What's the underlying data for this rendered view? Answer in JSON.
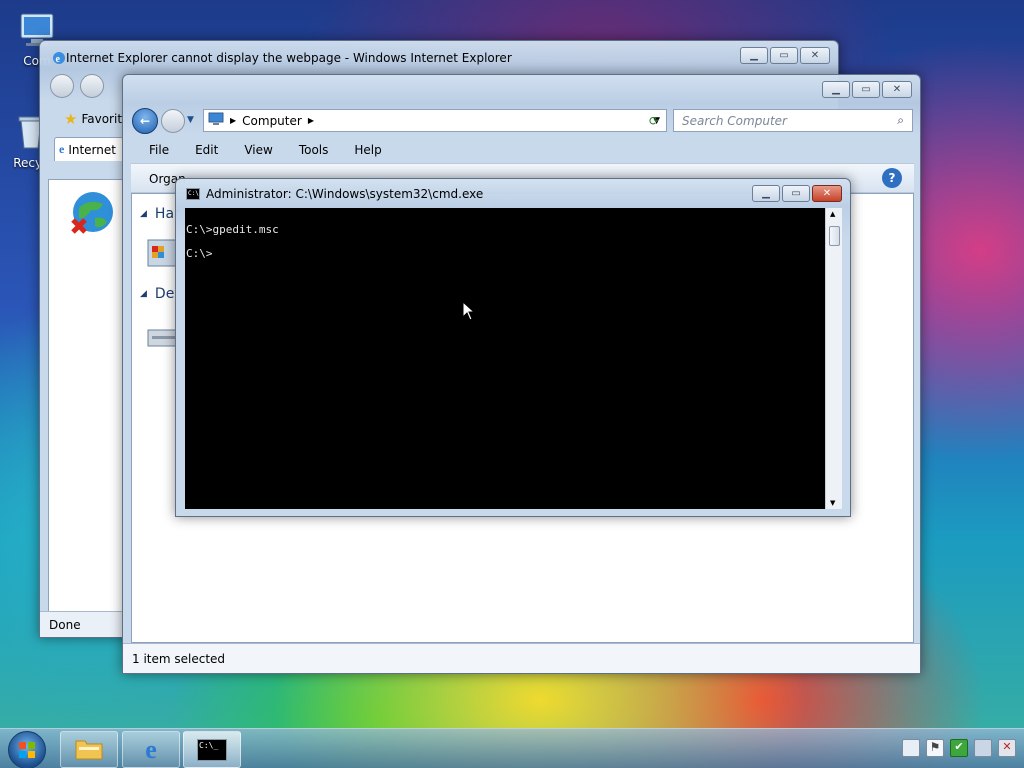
{
  "desktop": {
    "icons": [
      {
        "label": "Com"
      },
      {
        "label": "Recyc"
      }
    ]
  },
  "ie_window": {
    "title": "Internet Explorer cannot display the webpage - Windows Internet Explorer",
    "favorites_label": "Favorit",
    "tab_label": "Internet",
    "status": "Done"
  },
  "explorer_window": {
    "address": "Computer",
    "search_placeholder": "Search Computer",
    "menu": [
      "File",
      "Edit",
      "View",
      "Tools",
      "Help"
    ],
    "command_organize": "Organ",
    "sections": [
      "Har",
      "Dev"
    ],
    "status": "1 item selected"
  },
  "cmd_window": {
    "title": "Administrator: C:\\Windows\\system32\\cmd.exe",
    "lines": [
      "C:\\>gpedit.msc",
      "C:\\>"
    ]
  },
  "taskbar": {
    "buttons": [
      "Windows Explorer",
      "Internet Explorer",
      "Command Prompt"
    ]
  }
}
